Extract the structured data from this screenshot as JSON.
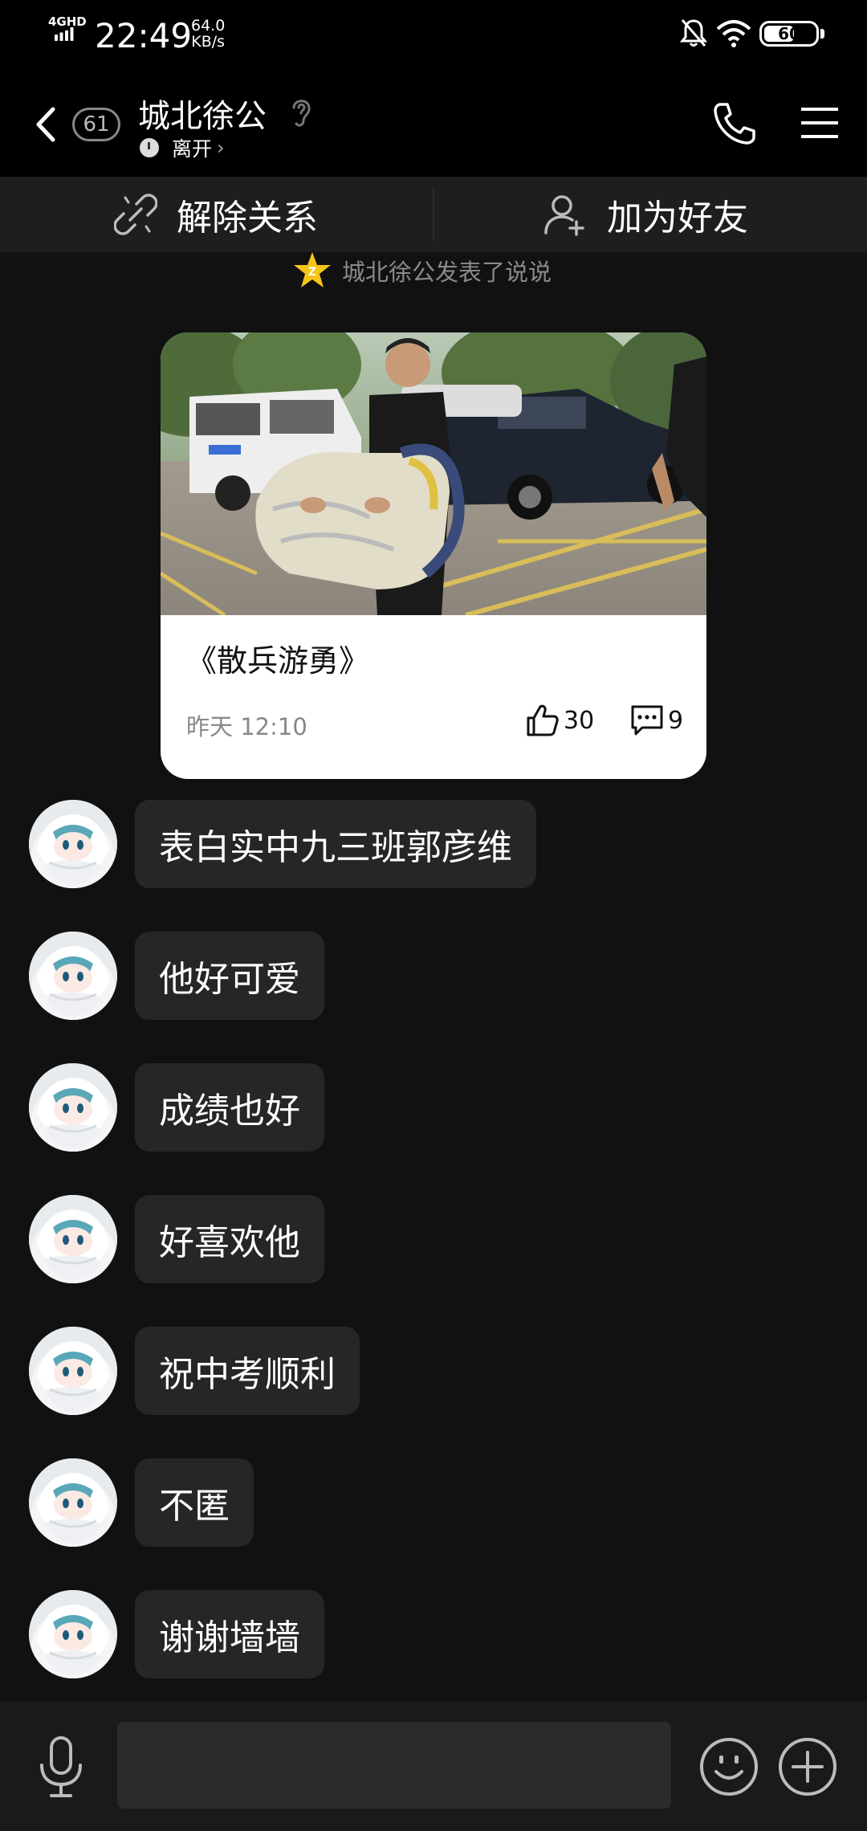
{
  "status_bar": {
    "network": "4GHD",
    "time": "22:49",
    "speed_value": "64.0",
    "speed_unit": "KB/s",
    "battery": "60",
    "battery_level": 0.6
  },
  "header": {
    "unread_count": "61",
    "title": "城北徐公",
    "presence": "离开",
    "icons": {
      "back": "back-chevron-icon",
      "ear": "ear-icon",
      "call": "phone-icon",
      "menu": "menu-icon"
    }
  },
  "actions": {
    "unlink_label": "解除关系",
    "add_friend_label": "加为好友"
  },
  "notice": {
    "text": "城北徐公发表了说说"
  },
  "post": {
    "title": "《散兵游勇》",
    "time": "昨天 12:10",
    "likes": "30",
    "comments": "9"
  },
  "messages": [
    {
      "text": "表白实中九三班郭彦维"
    },
    {
      "text": "他好可爱"
    },
    {
      "text": "成绩也好"
    },
    {
      "text": "好喜欢他"
    },
    {
      "text": "祝中考顺利"
    },
    {
      "text": "不匿"
    },
    {
      "text": "谢谢墙墙"
    }
  ],
  "input": {
    "value": "",
    "placeholder": ""
  },
  "colors": {
    "background": "#111111",
    "bubble": "#262626",
    "card": "#ffffff",
    "muted_text": "#8a8a8a",
    "star": "#f5c518"
  }
}
